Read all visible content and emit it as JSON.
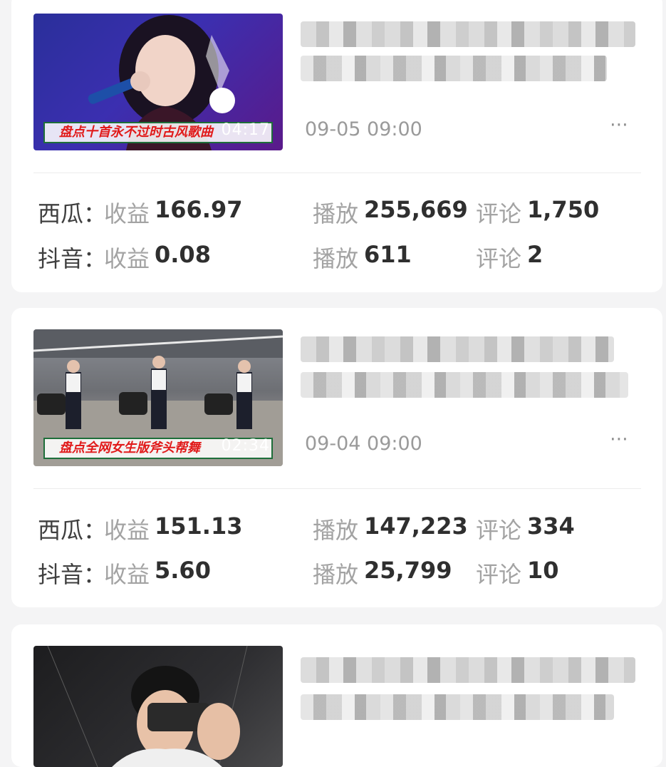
{
  "videos": [
    {
      "thumbnail": {
        "caption": "盘点十首永不过时古风歌曲",
        "duration": "04:17",
        "colors": {
          "bg_from": "#2a2f9a",
          "bg_to": "#5a1a8a",
          "caption_text": "#e11a1a"
        }
      },
      "date": "09-05 09:00",
      "more_icon": "⋯",
      "xigua": {
        "platform": "西瓜：",
        "revenue_label": "收益",
        "revenue": "166.97",
        "plays_label": "播放",
        "plays": "255,669",
        "comments_label": "评论",
        "comments": "1,750"
      },
      "douyin": {
        "platform": "抖音：",
        "revenue_label": "收益",
        "revenue": "0.08",
        "plays_label": "播放",
        "plays": "611",
        "comments_label": "评论",
        "comments": "2"
      }
    },
    {
      "thumbnail": {
        "caption": "盘点全网女生版斧头帮舞",
        "duration": "02:34",
        "colors": {
          "bg_from": "#6d6f74",
          "bg_to": "#b7b4ae",
          "caption_text": "#e11a1a"
        }
      },
      "date": "09-04 09:00",
      "more_icon": "⋯",
      "xigua": {
        "platform": "西瓜：",
        "revenue_label": "收益",
        "revenue": "151.13",
        "plays_label": "播放",
        "plays": "147,223",
        "comments_label": "评论",
        "comments": "334"
      },
      "douyin": {
        "platform": "抖音：",
        "revenue_label": "收益",
        "revenue": "5.60",
        "plays_label": "播放",
        "plays": "25,799",
        "comments_label": "评论",
        "comments": "10"
      }
    },
    {
      "thumbnail": {
        "caption": "",
        "duration": "",
        "colors": {
          "bg_from": "#1d1d1f",
          "bg_to": "#4a4a4c"
        }
      }
    }
  ]
}
